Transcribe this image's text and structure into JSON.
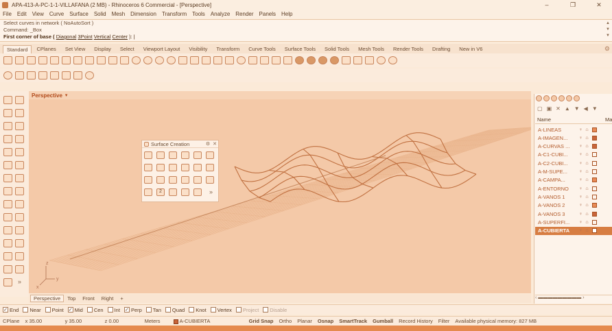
{
  "window": {
    "title": "APA-413-A-PC-1-1-VILLAFANA (2 MB) - Rhinoceros 6 Commercial - [Perspective]",
    "controls": [
      "–",
      "❐",
      "✕"
    ]
  },
  "menu": [
    "File",
    "Edit",
    "View",
    "Curve",
    "Surface",
    "Solid",
    "Mesh",
    "Dimension",
    "Transform",
    "Tools",
    "Analyze",
    "Render",
    "Panels",
    "Help"
  ],
  "command": {
    "history1": "Select curves in network ( NoAutoSort )",
    "history2": "Command: _Box",
    "prompt": "First corner of base (",
    "opt1": "Diagonal",
    "opt2": "3Point",
    "opt3": "Vertical",
    "opt4": "Center",
    "prompt_end": "): |"
  },
  "tabs": [
    "Standard",
    "CPlanes",
    "Set View",
    "Display",
    "Select",
    "Viewport Layout",
    "Visibility",
    "Transform",
    "Curve Tools",
    "Surface Tools",
    "Solid Tools",
    "Mesh Tools",
    "Render Tools",
    "Drafting",
    "New in V6"
  ],
  "viewport": {
    "name": "Perspective",
    "dropdown": "▾",
    "axis_z": "z",
    "axis_y": "y",
    "axis_x": "x"
  },
  "popup": {
    "title": "Surface Creation",
    "badge": "2",
    "more": "»"
  },
  "viewport_tabs": [
    "Perspective",
    "Top",
    "Front",
    "Right",
    "+"
  ],
  "panel": {
    "col_name": "Name",
    "col_material": "Ma",
    "layers": [
      {
        "name": "A-LINEAS",
        "color": "#e88a55"
      },
      {
        "name": "A-IMAGEN...",
        "color": "#c8643a"
      },
      {
        "name": "A-CURVAS ...",
        "color": "#c8643a"
      },
      {
        "name": "A-C1-CUBI...",
        "color": "#fdf3ea"
      },
      {
        "name": "A-C2-CUBI...",
        "color": "#fdf3ea"
      },
      {
        "name": "A-M-SUPE...",
        "color": "#fdf3ea"
      },
      {
        "name": "A-CAMPA...",
        "color": "#e88a55"
      },
      {
        "name": "A-ENTORNO",
        "color": "#fdf3ea"
      },
      {
        "name": "A-VANOS 1",
        "color": "#fdf3ea"
      },
      {
        "name": "A-VANOS 2",
        "color": "#e88a55"
      },
      {
        "name": "A-VANOS 3",
        "color": "#c8643a"
      },
      {
        "name": "A-SUPERFI...",
        "color": "#fdf3ea"
      },
      {
        "name": "A-CUBIERTA",
        "color": "#ffffff"
      }
    ]
  },
  "osnap": [
    {
      "label": "End",
      "checked": true
    },
    {
      "label": "Near",
      "checked": false
    },
    {
      "label": "Point",
      "checked": false
    },
    {
      "label": "Mid",
      "checked": true
    },
    {
      "label": "Cen",
      "checked": false
    },
    {
      "label": "Int",
      "checked": false
    },
    {
      "label": "Perp",
      "checked": true
    },
    {
      "label": "Tan",
      "checked": false
    },
    {
      "label": "Quad",
      "checked": false
    },
    {
      "label": "Knot",
      "checked": false
    },
    {
      "label": "Vertex",
      "checked": false
    },
    {
      "label": "Project",
      "checked": false
    },
    {
      "label": "Disable",
      "checked": false
    }
  ],
  "status": {
    "cplane": "CPlane",
    "x": "x 35.00",
    "y": "y 35.00",
    "z": "z 0.00",
    "units": "Meters",
    "layer": "A-CUBIERTA",
    "grid_snap": "Grid Snap",
    "ortho": "Ortho",
    "planar": "Planar",
    "osnap": "Osnap",
    "smarttrack": "SmartTrack",
    "gumball": "Gumball",
    "record_history": "Record History",
    "filter": "Filter",
    "memory": "Available physical memory: 827 MB"
  },
  "colors": {
    "accent": "#d77d42",
    "viewport_bg": "#f4c9a8",
    "grid_line": "#e9b48c",
    "wave_line": "#c07040"
  }
}
